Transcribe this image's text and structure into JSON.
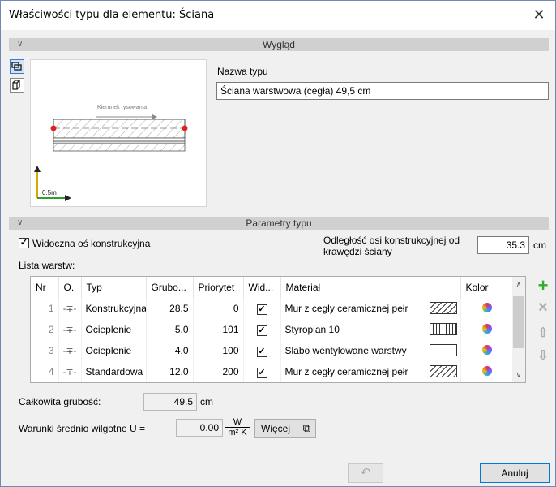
{
  "window": {
    "title": "Właściwości typu dla elementu: Ściana",
    "close_glyph": "✕"
  },
  "sections": {
    "appearance": "Wygląd",
    "parameters": "Parametry typu"
  },
  "sidebar": [
    {
      "name": "view-2d-icon",
      "active": true
    },
    {
      "name": "view-3d-icon",
      "active": false
    }
  ],
  "preview": {
    "direction_label": "Kierunek rysowania",
    "scale_label": "0.5m"
  },
  "type_name": {
    "label": "Nazwa typu",
    "value": "Ściana warstwowa (cegła) 49,5 cm"
  },
  "params": {
    "visible_axis_label": "Widoczna oś konstrukcyjna",
    "visible_axis_checked": true,
    "axis_offset_label": "Odległość osi konstrukcyjnej od krawędzi ściany",
    "axis_offset_value": "35.3",
    "axis_offset_unit": "cm",
    "layers_label": "Lista warstw:"
  },
  "layers_table": {
    "columns": [
      "Nr",
      "O.",
      "Typ",
      "Grubo...",
      "Priorytet",
      "Wid...",
      "Materiał",
      "Kolor"
    ],
    "rows": [
      {
        "nr": "1",
        "type": "Konstrukcyjna",
        "thickness": "28.5",
        "priority": "0",
        "visible": true,
        "material": "Mur z cegły ceramicznej pełr",
        "swatch": "hatch"
      },
      {
        "nr": "2",
        "type": "Ocieplenie",
        "thickness": "5.0",
        "priority": "101",
        "visible": true,
        "material": "Styropian 10",
        "swatch": "zigzag"
      },
      {
        "nr": "3",
        "type": "Ocieplenie",
        "thickness": "4.0",
        "priority": "100",
        "visible": true,
        "material": "Słabo wentylowane warstwy",
        "swatch": "empty"
      },
      {
        "nr": "4",
        "type": "Standardowa",
        "thickness": "12.0",
        "priority": "200",
        "visible": true,
        "material": "Mur z cegły ceramicznej pełr",
        "swatch": "hatch"
      }
    ]
  },
  "tools": {
    "add": "+",
    "remove": "✕",
    "up": "⇧",
    "down": "⇩"
  },
  "total": {
    "label": "Całkowita grubość:",
    "value": "49.5",
    "unit": "cm"
  },
  "u_value": {
    "label": "Warunki średnio wilgotne U =",
    "value": "0.00",
    "unit_num": "W",
    "unit_den": "m² K",
    "more_button": "Więcej"
  },
  "footer": {
    "undo_glyph": "↶",
    "cancel_button": "Anuluj"
  },
  "colors": {
    "section_header": "#d0d0d0",
    "accent": "#3b78c8",
    "add_green": "#2fae2f"
  }
}
